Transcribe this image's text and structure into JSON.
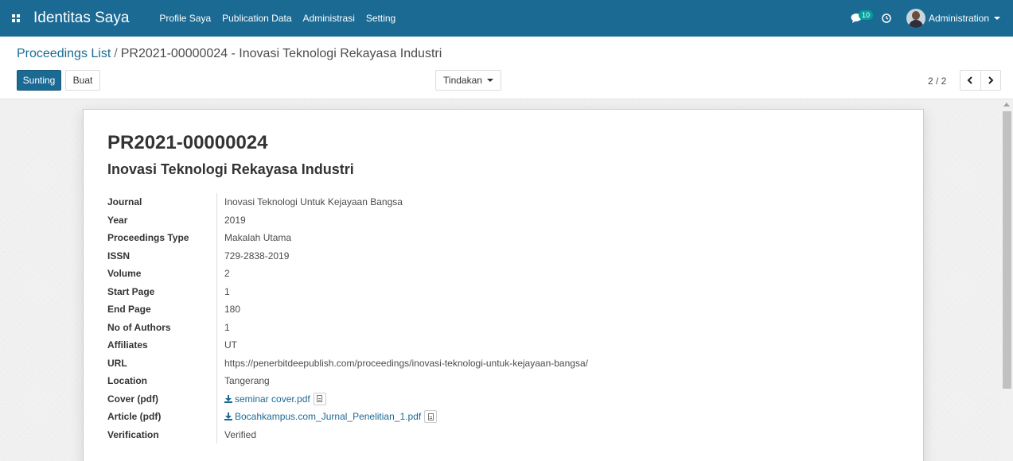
{
  "navbar": {
    "brand": "Identitas Saya",
    "menu": [
      "Profile Saya",
      "Publication Data",
      "Administrasi",
      "Setting"
    ],
    "messages_count": "10",
    "user_name": "Administration"
  },
  "breadcrumb": {
    "parent": "Proceedings List",
    "separator": "/",
    "current": "PR2021-00000024 - Inovasi Teknologi Rekayasa Industri"
  },
  "buttons": {
    "edit": "Sunting",
    "create": "Buat",
    "action": "Tindakan"
  },
  "pager": {
    "value": "2 / 2"
  },
  "record": {
    "code": "PR2021-00000024",
    "title": "Inovasi Teknologi Rekayasa Industri",
    "fields": [
      {
        "label": "Journal",
        "value": "Inovasi Teknologi Untuk Kejayaan Bangsa"
      },
      {
        "label": "Year",
        "value": "2019"
      },
      {
        "label": "Proceedings Type",
        "value": "Makalah Utama"
      },
      {
        "label": "ISSN",
        "value": "729-2838-2019"
      },
      {
        "label": "Volume",
        "value": "2"
      },
      {
        "label": "Start Page",
        "value": "1"
      },
      {
        "label": "End Page",
        "value": "180"
      },
      {
        "label": "No of Authors",
        "value": "1"
      },
      {
        "label": "Affiliates",
        "value": "UT"
      },
      {
        "label": "URL",
        "value": "https://penerbitdeepublish.com/proceedings/inovasi-teknologi-untuk-kejayaan-bangsa/"
      },
      {
        "label": "Location",
        "value": "Tangerang"
      },
      {
        "label": "Cover (pdf)",
        "value": "seminar cover.pdf"
      },
      {
        "label": "Article (pdf)",
        "value": "Bocahkampus.com_Jurnal_Penelitian_1.pdf"
      },
      {
        "label": "Verification",
        "value": "Verified"
      }
    ]
  },
  "colors": {
    "navbar": "#1b6a94",
    "primary_button": "#1b6a94",
    "link": "#1b6a94",
    "badge": "#00a09d"
  }
}
